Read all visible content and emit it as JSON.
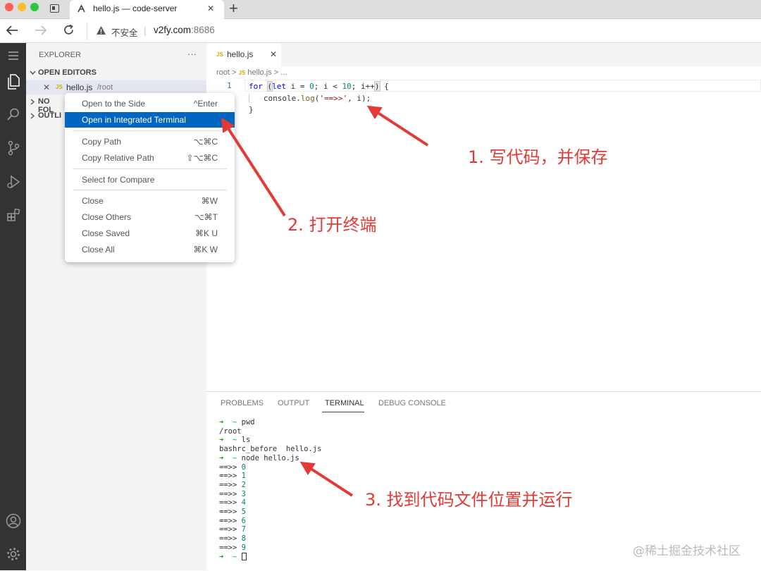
{
  "browser": {
    "tab_title": "hello.js — code-server",
    "tab_close": "✕",
    "new_tab": "+",
    "security_label": "不安全",
    "url_host": "v2fy.com",
    "url_port": ":8686"
  },
  "sidebar": {
    "title": "EXPLORER",
    "more": "···",
    "open_editors": "OPEN EDITORS",
    "open_file": {
      "icon": "JS",
      "name": "hello.js",
      "path": "/root"
    },
    "no_folder": "NO FOL",
    "outline": "OUTLI"
  },
  "context_menu": {
    "items": [
      {
        "label": "Open to the Side",
        "shortcut": "^Enter"
      },
      {
        "label": "Open in Integrated Terminal",
        "shortcut": ""
      },
      {
        "label": "Copy Path",
        "shortcut": "⌥⌘C"
      },
      {
        "label": "Copy Relative Path",
        "shortcut": "⇧⌥⌘C"
      },
      {
        "label": "Select for Compare",
        "shortcut": ""
      },
      {
        "label": "Close",
        "shortcut": "⌘W"
      },
      {
        "label": "Close Others",
        "shortcut": "⌥⌘T"
      },
      {
        "label": "Close Saved",
        "shortcut": "⌘K U"
      },
      {
        "label": "Close All",
        "shortcut": "⌘K W"
      }
    ]
  },
  "editor": {
    "tab_icon": "JS",
    "tab_label": "hello.js",
    "breadcrumb": {
      "root": "root",
      "sep": ">",
      "icon": "JS",
      "file": "hello.js",
      "more": "..."
    },
    "line_number": "1",
    "code": {
      "kw_for": "for",
      "kw_let": "let",
      "l1_a": " i = ",
      "num_0": "0",
      "l1_b": "; i < ",
      "num_10": "10",
      "l1_c": "; i++",
      "l1_d": " {",
      "l2_a": "console.",
      "l2_fn": "log",
      "l2_b": "(",
      "l2_str": "'==>>'",
      "l2_c": ", i);",
      "l3": "}"
    }
  },
  "panel": {
    "tabs": [
      "PROBLEMS",
      "OUTPUT",
      "TERMINAL",
      "DEBUG CONSOLE"
    ],
    "active_tab": "TERMINAL",
    "terminal": {
      "prompt": "➜",
      "tilde": "~",
      "cmd1": "pwd",
      "out1": "/root",
      "cmd2": "ls",
      "out2": "bashrc_before  hello.js",
      "cmd3": "node hello.js",
      "out_prefix": "==>>",
      "out_values": [
        "0",
        "1",
        "2",
        "3",
        "4",
        "5",
        "6",
        "7",
        "8",
        "9"
      ],
      "cursor": ""
    }
  },
  "annotations": {
    "a1": "1. 写代码，并保存",
    "a2": "2. 打开终端",
    "a3": "3. 找到代码文件位置并运行"
  },
  "watermark": "@稀土掘金技术社区",
  "colors": {
    "accent": "#0066bf",
    "arrow": "#e53935",
    "js_icon": "#c5b000",
    "keyword": "#0000ff",
    "number": "#098658",
    "string": "#a31515",
    "term_green": "#13a10e"
  }
}
